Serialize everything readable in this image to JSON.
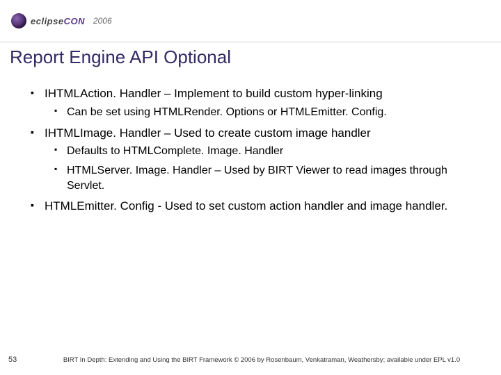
{
  "header": {
    "logo_prefix": "eclipse",
    "logo_suffix": "CON",
    "year": "2006"
  },
  "title": "Report Engine API Optional",
  "bullets": [
    {
      "text": "IHTMLAction. Handler – Implement to build custom hyper-linking",
      "sub": [
        {
          "text": "Can be set using HTMLRender. Options or HTMLEmitter. Config."
        }
      ]
    },
    {
      "text": "IHTMLImage. Handler – Used to create custom image handler",
      "sub": [
        {
          "text": "Defaults to HTMLComplete. Image. Handler"
        },
        {
          "text": "HTMLServer. Image. Handler – Used by BIRT Viewer to read images through Servlet."
        }
      ]
    },
    {
      "text": "HTMLEmitter. Config  - Used to set custom action handler and image handler.",
      "sub": []
    }
  ],
  "footer": {
    "page": "53",
    "text": "BIRT In Depth: Extending and Using the BIRT Framework © 2006 by Rosenbaum, Venkatraman, Weathersby; available under EPL v1.0"
  }
}
